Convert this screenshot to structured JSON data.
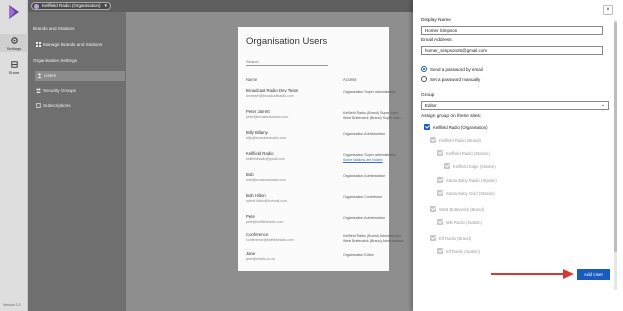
{
  "app": {
    "org_switcher": "Kellfield Radio (Organisation)",
    "version": "Version 2.0"
  },
  "rail": [
    {
      "icon": "gear-icon",
      "label": "Settings"
    },
    {
      "icon": "share-icon",
      "label": "Share"
    }
  ],
  "sidebar": {
    "brands_header": "Brands and Stations",
    "manage_brands": "Manage Brands and Stations",
    "org_header": "Organisation Settings",
    "users": "Users",
    "security_groups": "Security Groups",
    "subscriptions": "Subscriptions"
  },
  "users_page": {
    "title": "Organisation Users",
    "search_placeholder": "Search",
    "col_name": "Name",
    "col_access": "Access",
    "rows": [
      {
        "name": "Broadcast Radio Dev Team",
        "email": "devteam@broadcastradio.com",
        "access1": "Organisation  Super administrator",
        "access2": ""
      },
      {
        "name": "Peter Jarrett",
        "email": "peter@broadcastradio.com",
        "access1": "Kellfield Radio (Brand)      Super Adm",
        "access2": "West Butterwick (Brand)    Super Adm"
      },
      {
        "name": "Billy Billany",
        "email": "billy@broadcastradio.com",
        "access1": "Organisation  Administrator",
        "access2": ""
      },
      {
        "name": "Kellfield Radio",
        "email": "kellfieldradio@gmail.com",
        "access1": "Organisation  Super administrator",
        "access2": "Some stations are hidden"
      },
      {
        "name": "Bob",
        "email": "bob@broadcastradio.com",
        "access1": "Organisation  Administrator",
        "access2": ""
      },
      {
        "name": "Bob Hilton",
        "email": "robert.hilton@hotmail.com",
        "access1": "Organisation  Contributor",
        "access2": ""
      },
      {
        "name": "Pete",
        "email": "pete@kellfieldradio.com",
        "access1": "Organisation  Administrator",
        "access2": ""
      },
      {
        "name": "Conference",
        "email": "conference@kellfieldradio.com",
        "access1": "Kellfield Radio (Brand)    Administrator",
        "access2": "West Butterwick (Brand)    Administrator"
      },
      {
        "name": "Jane",
        "email": "jane@kradio.co.uk",
        "access1": "Organisation  Editor",
        "access2": ""
      }
    ]
  },
  "panel": {
    "display_name_label": "Display Name",
    "display_name_value": "Homer Simpson",
    "email_label": "Email Address",
    "email_value": "homer_simpson26@gmail.com",
    "radio_email": "Send a password by email",
    "radio_manual": "Set a password manually",
    "group_label": "Group",
    "group_value": "Editor",
    "assign_label": "Assign group on these sites:",
    "tree": [
      {
        "label": "Kellfield Radio (Organisation)",
        "level": 0,
        "enabled": true
      },
      {
        "label": "Kellfield Radio (Brand)",
        "level": 1,
        "enabled": false
      },
      {
        "label": "Kellfield Radio (Station)",
        "level": 2,
        "enabled": false
      },
      {
        "label": "Kellfield Edge (Station)",
        "level": 3,
        "enabled": false
      },
      {
        "label": "Santa Baby Radio (Station)",
        "level": 2,
        "enabled": false
      },
      {
        "label": "Santa Baby Gold (Station)",
        "level": 2,
        "enabled": false
      },
      {
        "label": "West Butterwick (Brand)",
        "level": 1,
        "enabled": false
      },
      {
        "label": "WB Radio (Station)",
        "level": 2,
        "enabled": false
      },
      {
        "label": "Elf Radio (Brand)",
        "level": 1,
        "enabled": false
      },
      {
        "label": "Elf Radio (Station)",
        "level": 2,
        "enabled": false
      }
    ],
    "add_button": "Add User",
    "close": "×"
  },
  "colors": {
    "accent": "#1a5bc0",
    "arrow": "#d23b34",
    "sidebar": "#6f6f6f",
    "overlay": "#8e8e8e"
  }
}
